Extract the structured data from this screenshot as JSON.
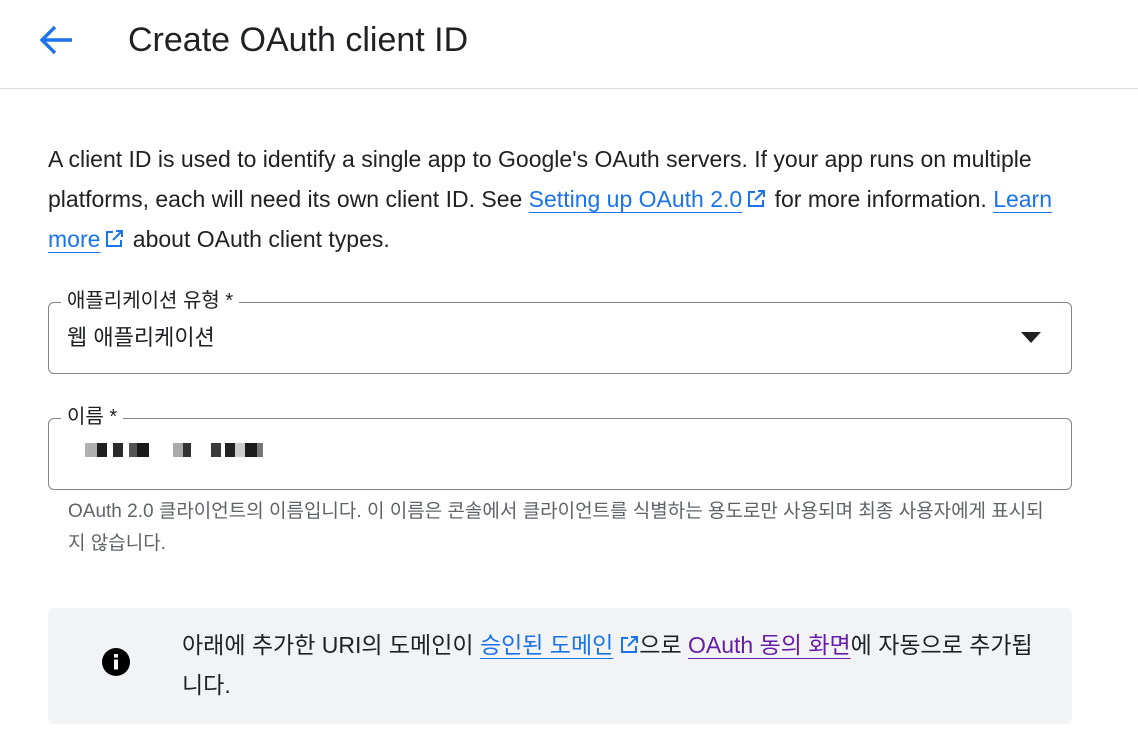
{
  "header": {
    "back_icon": "arrow-left-icon",
    "title": "Create OAuth client ID"
  },
  "intro": {
    "text_1": "A client ID is used to identify a single app to Google's OAuth servers. If your app runs on multiple platforms, each will need its own client ID. See ",
    "link_1": "Setting up OAuth 2.0",
    "text_2": " for more information. ",
    "link_2": "Learn more",
    "text_3": " about OAuth client types."
  },
  "app_type_field": {
    "label": "애플리케이션 유형 *",
    "value": "웹 애플리케이션",
    "icon": "dropdown-arrow-icon"
  },
  "name_field": {
    "label": "이름 *",
    "hint": "OAuth 2.0 클라이언트의 이름입니다. 이 이름은 콘솔에서 클라이언트를 식별하는 용도로만 사용되며 최종 사용자에게 표시되지 않습니다."
  },
  "info_box": {
    "icon": "info-icon",
    "text_1": "아래에 추가한 URI의 도메인이 ",
    "link_1": "승인된 도메인",
    "text_2": "으로 ",
    "link_2": "OAuth 동의 화면",
    "text_3": "에 자동으로 추가됩니다."
  },
  "colors": {
    "primary_blue": "#1a73e8",
    "visited_purple": "#681da8",
    "border": "#80868b",
    "info_bg": "#f1f3f4",
    "hint_text": "#5f6368"
  }
}
